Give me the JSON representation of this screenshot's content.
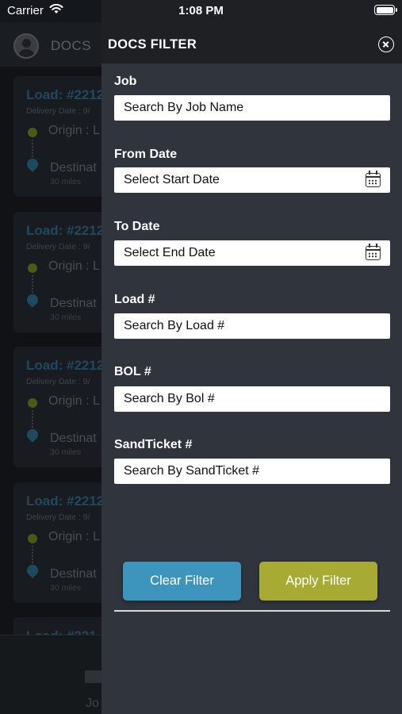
{
  "status_bar": {
    "carrier": "Carrier",
    "time": "1:08 PM"
  },
  "background": {
    "header_title": "DOCS",
    "cards": [
      {
        "load": "Load: #2212",
        "date": "Delivery Date : 9/",
        "origin": "Origin : L",
        "destination": "Destinat",
        "miles": "30 miles"
      },
      {
        "load": "Load: #2212",
        "date": "Delivery Date : 9/",
        "origin": "Origin : L",
        "destination": "Destinat",
        "miles": "30 miles"
      },
      {
        "load": "Load: #2212",
        "date": "Delivery Date : 9/",
        "origin": "Origin : L",
        "destination": "Destinat",
        "miles": "30 miles"
      },
      {
        "load": "Load: #2212",
        "date": "Delivery Date : 9/",
        "origin": "Origin : L",
        "destination": "Destinat",
        "miles": "30 miles"
      }
    ],
    "partial_card_load": "Load: #221",
    "tab_label": "Jo"
  },
  "drawer": {
    "title": "DOCS FILTER",
    "fields": {
      "job": {
        "label": "Job",
        "placeholder": "Search By Job Name"
      },
      "from_date": {
        "label": "From Date",
        "placeholder": "Select Start Date"
      },
      "to_date": {
        "label": "To Date",
        "placeholder": "Select End Date"
      },
      "load": {
        "label": "Load #",
        "placeholder": "Search By Load #"
      },
      "bol": {
        "label": "BOL #",
        "placeholder": "Search By Bol #"
      },
      "sand_ticket": {
        "label": "SandTicket #",
        "placeholder": "Search By SandTicket #"
      }
    },
    "clear_label": "Clear Filter",
    "apply_label": "Apply Filter"
  },
  "colors": {
    "clear": "#3d95be",
    "apply": "#a7ab33",
    "drawer_bg": "#2f343d"
  }
}
